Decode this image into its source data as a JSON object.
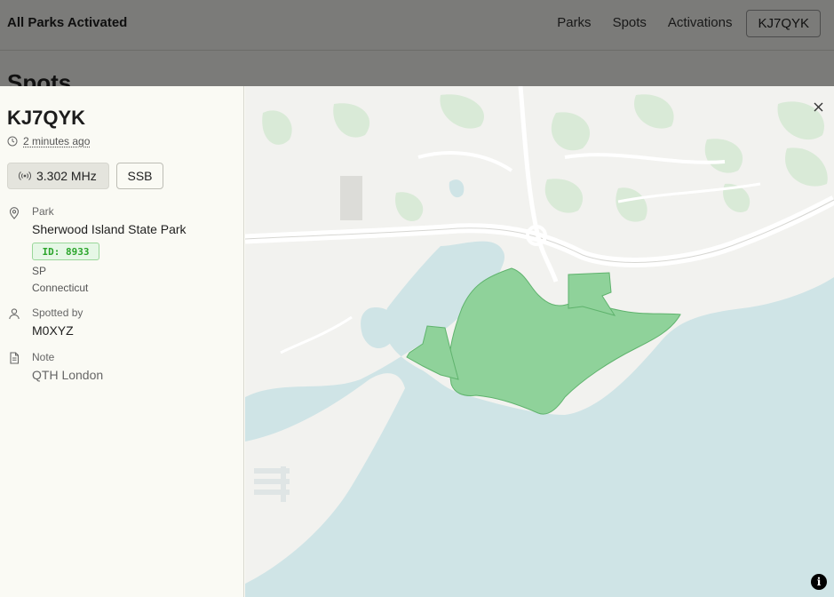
{
  "nav": {
    "brand": "All Parks Activated",
    "links": [
      "Parks",
      "Spots",
      "Activations"
    ],
    "user_button": "KJ7QYK"
  },
  "page": {
    "heading": "Spots"
  },
  "spot": {
    "callsign": "KJ7QYK",
    "time_ago": "2 minutes ago",
    "frequency": "3.302 MHz",
    "mode": "SSB",
    "park_label": "Park",
    "park_name": "Sherwood Island State Park",
    "park_id": "ID: 8933",
    "park_type": "SP",
    "park_state": "Connecticut",
    "spotter_label": "Spotted by",
    "spotter": "M0XYZ",
    "note_label": "Note",
    "note": "QTH London"
  },
  "icons": {
    "clock": "clock-icon",
    "radio": "broadcast-icon",
    "pin": "map-pin-icon",
    "user": "user-icon",
    "note": "document-icon",
    "close": "close-icon",
    "info": "info-icon"
  },
  "map": {
    "info_glyph": "i",
    "colors": {
      "water": "#cfe4e6",
      "land": "#f2f2ef",
      "park": "#8fd29a",
      "road": "#ffffff",
      "green": "#d8ead6"
    }
  }
}
